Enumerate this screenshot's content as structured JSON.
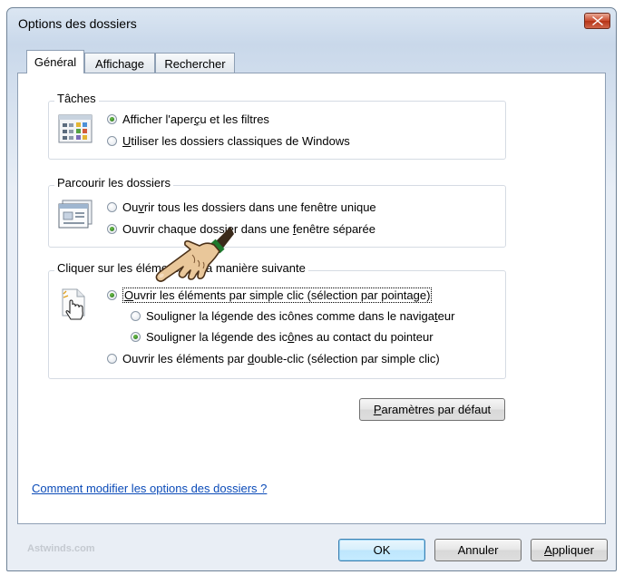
{
  "window": {
    "title": "Options des dossiers",
    "close_icon": "close-icon"
  },
  "tabs": [
    {
      "label": "Général",
      "active": true
    },
    {
      "label": "Affichage",
      "active": false
    },
    {
      "label": "Rechercher",
      "active": false
    }
  ],
  "groups": {
    "taches": {
      "title": "Tâches",
      "icon": "folder-tasks-icon",
      "options": [
        {
          "pre": "Afficher l'aper",
          "key": "ç",
          "post": "u et les filtres",
          "checked": true
        },
        {
          "pre": "",
          "key": "U",
          "post": "tiliser les dossiers classiques de Windows",
          "checked": false
        }
      ]
    },
    "parcourir": {
      "title": "Parcourir les dossiers",
      "icon": "window-icon",
      "options": [
        {
          "pre": "Ou",
          "key": "v",
          "post": "rir tous les dossiers dans une fenêtre unique",
          "checked": false
        },
        {
          "pre": "Ouvrir chaque dossier dans une ",
          "key": "f",
          "post": "enêtre séparée",
          "checked": true
        }
      ]
    },
    "cliquer": {
      "title": "Cliquer sur les éléments de la manière suivante",
      "icon": "hand-cursor-icon",
      "options": [
        {
          "pre": "",
          "key": "O",
          "post": "uvrir les éléments par simple clic (sélection par pointage)",
          "checked": true
        },
        {
          "pre": "Souligner la légende des icônes comme dans le naviga",
          "key": "t",
          "post": "eur",
          "checked": false
        },
        {
          "pre": "Souligner la légende des ic",
          "key": "ô",
          "post": "nes au contact du pointeur",
          "checked": true
        },
        {
          "pre": "Ouvrir les éléments par ",
          "key": "d",
          "post": "ouble-clic (sélection par simple clic)",
          "checked": false
        }
      ]
    }
  },
  "restore_button": {
    "key": "P",
    "post": "aramètres par défaut"
  },
  "help_link": "Comment modifier les options des dossiers ?",
  "watermark": "Astwinds.com",
  "buttons": {
    "ok": "OK",
    "cancel": "Annuler",
    "apply_key": "A",
    "apply_post": "ppliquer"
  },
  "overlay": {
    "icon": "pointing-hand-icon"
  }
}
